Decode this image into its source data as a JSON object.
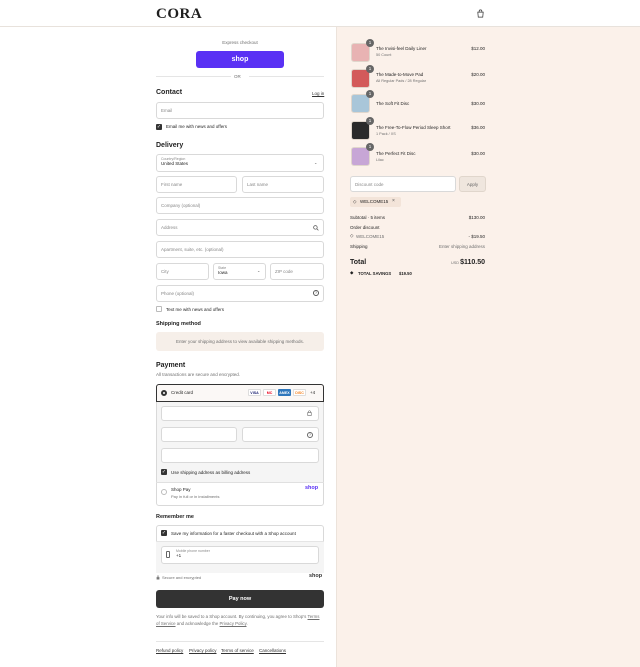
{
  "brand": "CORA",
  "express": {
    "title": "Express checkout",
    "shop_button": "shop",
    "or": "OR"
  },
  "contact": {
    "title": "Contact",
    "login": "Log in",
    "email_placeholder": "Email",
    "news_label": "Email me with news and offers"
  },
  "delivery": {
    "title": "Delivery",
    "country_label": "Country/Region",
    "country_value": "United States",
    "first_name": "First name",
    "last_name": "Last name",
    "company": "Company (optional)",
    "address": "Address",
    "apartment": "Apartment, suite, etc. (optional)",
    "city": "City",
    "state_label": "State",
    "state_value": "Iowa",
    "zip": "ZIP code",
    "phone": "Phone (optional)",
    "text_label": "Text me with news and offers"
  },
  "shipping_method": {
    "title": "Shipping method",
    "note": "Enter your shipping address to view available shipping methods."
  },
  "payment": {
    "title": "Payment",
    "subtitle": "All transactions are secure and encrypted.",
    "credit_card": "Credit card",
    "card_logos": [
      "VISA",
      "MC",
      "AMEX",
      "DISC"
    ],
    "more_cards": "+4",
    "billing_label": "Use shipping address as billing address",
    "shop_pay": "Shop Pay",
    "shop_pay_sub": "Pay in full or in installments",
    "shop_pay_logo": "shop"
  },
  "remember": {
    "title": "Remember me",
    "save_label": "Save my information for a faster checkout with a Shop account",
    "phone_label": "Mobile phone number",
    "phone_value": "+1",
    "secure": "Secure and encrypted",
    "shop_logo": "shop"
  },
  "pay_button": "Pay now",
  "legal": {
    "text1": "Your info will be saved to a Shop account. By continuing, you agree to Shop’s",
    "terms": "Terms of Service",
    "and": "and acknowledge the",
    "privacy": "Privacy Policy",
    "end": "."
  },
  "footer_links": [
    "Refund policy",
    "Privacy policy",
    "Terms of service",
    "Cancellations"
  ],
  "order": {
    "items": [
      {
        "name": "The Invisi-feel Daily Liner",
        "variant": "50 Count",
        "price": "$12.00",
        "qty": "1",
        "color": "#e8b3b3"
      },
      {
        "name": "The Made-to-Move Pad",
        "variant": "All Regular Pads / 28 Regular",
        "price": "$20.00",
        "qty": "1",
        "color": "#d35a5a"
      },
      {
        "name": "The Soft Fit Disc",
        "variant": "",
        "price": "$30.00",
        "qty": "1",
        "color": "#a9c6d9"
      },
      {
        "name": "The Free-To-Flow Period Sleep Short",
        "variant": "1 Pack / XS",
        "price": "$36.00",
        "qty": "1",
        "color": "#2a2a2a"
      },
      {
        "name": "The Perfect Fit Disc",
        "variant": "Lilac",
        "price": "$30.00",
        "qty": "1",
        "color": "#c7a6d6"
      }
    ],
    "discount_placeholder": "Discount code",
    "apply": "Apply",
    "code": "WELCOME15",
    "subtotal_label": "Subtotal · 5 items",
    "subtotal": "$130.00",
    "order_discount_label": "Order discount",
    "discount_code": "WELCOME15",
    "discount_value": "- $19.50",
    "shipping_label": "Shipping",
    "shipping_value": "Enter shipping address",
    "total_label": "Total",
    "currency": "USD",
    "total": "$110.50",
    "savings_label": "TOTAL SAVINGS",
    "savings": "$19.50"
  }
}
